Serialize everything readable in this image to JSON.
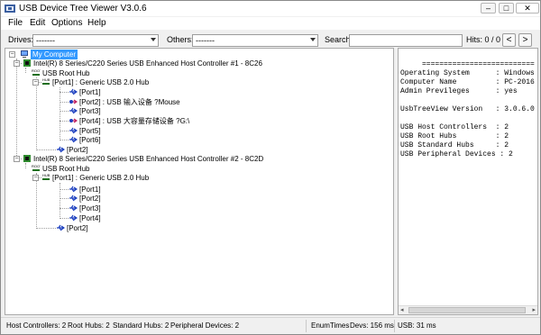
{
  "window": {
    "title": "USB Device Tree Viewer V3.0.6",
    "buttons": {
      "minimize": "–",
      "maximize": "□",
      "close": "✕"
    }
  },
  "menu": [
    "File",
    "Edit",
    "Options",
    "Help"
  ],
  "toolbar": {
    "drives_label": "Drives:",
    "drives_value": "-------",
    "others_label": "Others:",
    "others_value": "-------",
    "search_label": "Search:",
    "search_value": "",
    "hits": "Hits: 0 / 0",
    "prev": "<",
    "next": ">"
  },
  "tree": {
    "my_computer": "My Computer",
    "controller1": "Intel(R) 8 Series/C220 Series USB Enhanced Host Controller #1 - 8C26",
    "c1_root_hub": "USB Root Hub",
    "c1_port1": "[Port1] : Generic USB 2.0 Hub",
    "c1_p1_ports": [
      "[Port1]",
      "[Port2] : USB 输入设备 ?Mouse",
      "[Port3]",
      "[Port4] : USB 大容量存储设备 ?G:\\",
      "[Port5]",
      "[Port6]"
    ],
    "c1_port2": "[Port2]",
    "controller2": "Intel(R) 8 Series/C220 Series USB Enhanced Host Controller #2 - 8C2D",
    "c2_root_hub": "USB Root Hub",
    "c2_port1": "[Port1] : Generic USB 2.0 Hub",
    "c2_p1_ports": [
      "[Port1]",
      "[Port2]",
      "[Port3]",
      "[Port4]"
    ],
    "c2_port2": "[Port2]"
  },
  "info": {
    "lines": [
      "     ========================== M",
      "Operating System      : Windows",
      "Computer Name         : PC-2016",
      "Admin Previleges      : yes",
      "",
      "UsbTreeView Version   : 3.0.6.0",
      "",
      "USB Host Controllers  : 2",
      "USB Root Hubs         : 2",
      "USB Standard Hubs     : 2",
      "USB Peripheral Devices : 2"
    ]
  },
  "status": {
    "host_controllers": "Host Controllers: 2",
    "root_hubs": "Root Hubs: 2",
    "standard_hubs": "Standard Hubs: 2",
    "peripheral_devices": "Peripheral Devices: 2",
    "enum_times": "EnumTimes",
    "devs": "Devs: 156 ms",
    "usb": "USB: 31 ms"
  }
}
